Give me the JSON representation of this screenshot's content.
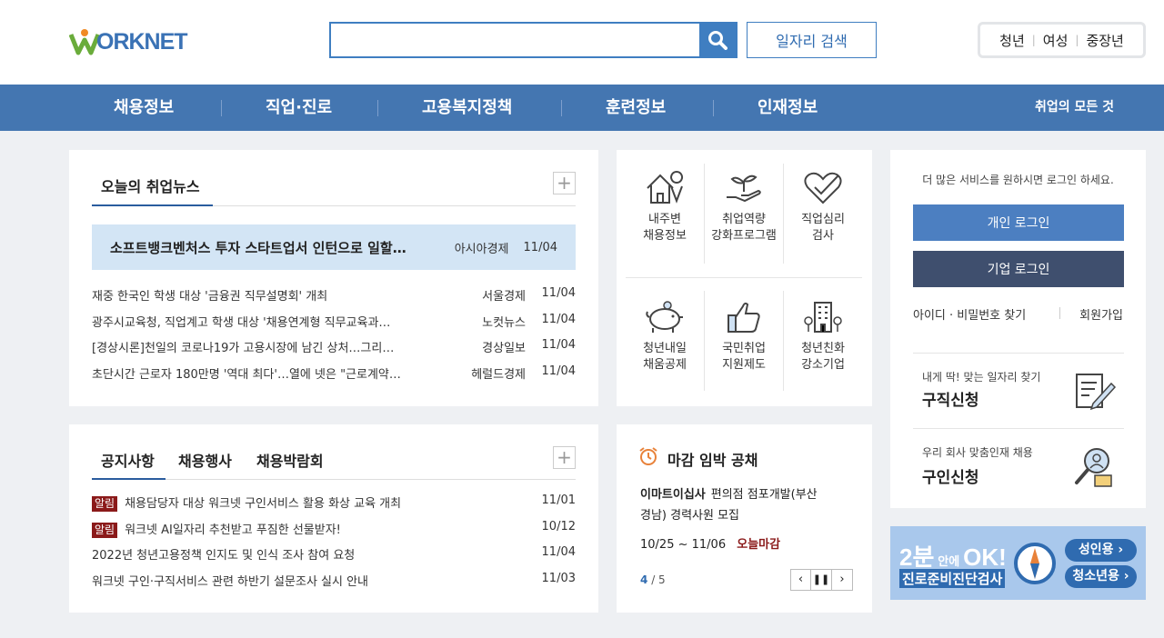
{
  "header": {
    "logo_text": "ORKNET",
    "search_placeholder": "",
    "job_search_label": "일자리 검색",
    "targets": [
      "청년",
      "여성",
      "중장년"
    ]
  },
  "nav": {
    "items": [
      "채용정보",
      "직업·진로",
      "고용복지정책",
      "훈련정보",
      "인재정보"
    ],
    "all_label": "취업의 모든 것"
  },
  "news": {
    "tab_label": "오늘의 취업뉴스",
    "headline": {
      "title": "소프트뱅크벤처스 투자 스타트업서 인턴으로 일할…",
      "source": "아시아경제",
      "date": "11/04"
    },
    "items": [
      {
        "title": "재중 한국인 학생 대상 '금융권 직무설명회' 개최",
        "source": "서울경제",
        "date": "11/04"
      },
      {
        "title": "광주시교육청, 직업계고 학생 대상 '채용연계형 직무교육과…",
        "source": "노컷뉴스",
        "date": "11/04"
      },
      {
        "title": "[경상시론]천일의 코로나19가 고용시장에 남긴 상처…그리…",
        "source": "경상일보",
        "date": "11/04"
      },
      {
        "title": "초단시간 근로자 180만명 '역대 최다'…열에 넷은 \"근로계약…",
        "source": "헤럴드경제",
        "date": "11/04"
      }
    ]
  },
  "services": [
    {
      "line1": "내주변",
      "line2": "채용정보",
      "icon": "house-location-icon"
    },
    {
      "line1": "취업역량",
      "line2": "강화프로그램",
      "icon": "sprout-hand-icon"
    },
    {
      "line1": "직업심리",
      "line2": "검사",
      "icon": "heart-check-icon"
    },
    {
      "line1": "청년내일",
      "line2": "채움공제",
      "icon": "piggy-bank-icon"
    },
    {
      "line1": "국민취업",
      "line2": "지원제도",
      "icon": "thumbs-up-icon"
    },
    {
      "line1": "청년친화",
      "line2": "강소기업",
      "icon": "building-icon"
    }
  ],
  "login": {
    "prompt": "더 많은 서비스를 원하시면 로그인 하세요.",
    "personal": "개인 로그인",
    "company": "기업 로그인",
    "find": "아이디 · 비밀번호 찾기",
    "join": "회원가입",
    "job_apply_sub": "내게 딱! 맞는 일자리 찾기",
    "job_apply_title": "구직신청",
    "hire_sub": "우리 회사 맞춤인재 채용",
    "hire_title": "구인신청"
  },
  "notice": {
    "tabs": [
      "공지사항",
      "채용행사",
      "채용박람회"
    ],
    "items": [
      {
        "badge": "알림",
        "title": "채용담당자 대상 워크넷 구인서비스 활용 화상 교육 개최",
        "date": "11/01"
      },
      {
        "badge": "알림",
        "title": "워크넷 AI일자리 추천받고 푸짐한 선물받자!",
        "date": "10/12"
      },
      {
        "badge": "",
        "title": "2022년 청년고용정책 인지도 및 인식 조사 참여 요청",
        "date": "11/04"
      },
      {
        "badge": "",
        "title": "워크넷 구인·구직서비스 관련 하반기 설문조사 실시 안내",
        "date": "11/03"
      }
    ]
  },
  "deadline": {
    "title": "마감 임박 공채",
    "company": "이마트이십사",
    "desc1": "편의점 점포개발(부산",
    "desc2": "경남) 경력사원 모집",
    "period": "10/25 ~ 11/06",
    "status": "오늘마감",
    "page_current": "4",
    "page_total": "/ 5"
  },
  "banner": {
    "headline_big": "2분",
    "headline_small": "안에",
    "headline_ok": "OK!",
    "subtitle": "진로준비진단검사",
    "adult": "성인용",
    "youth": "청소년용"
  },
  "colors": {
    "nav": "#4476b1",
    "accent": "#3f7ec1",
    "company_btn": "#3f4f6e",
    "badge": "#8b1a1a"
  }
}
